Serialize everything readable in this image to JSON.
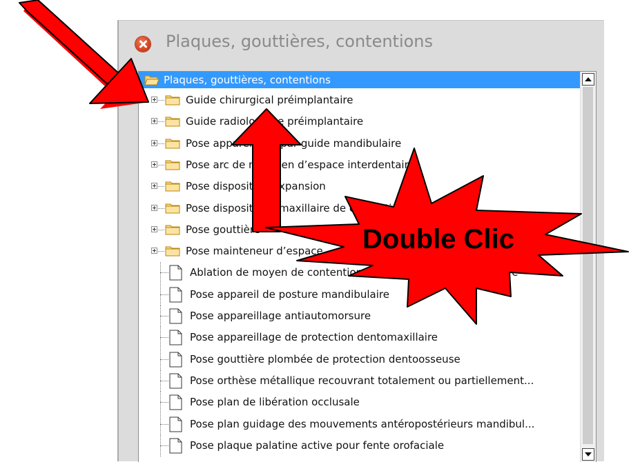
{
  "window": {
    "title": "Plaques, gouttières, contentions"
  },
  "tree": {
    "root_label": "Plaques, gouttières, contentions",
    "folders": [
      "Guide chirurgical préimplantaire",
      "Guide radiologique préimplantaire",
      "Pose appareillage par guide mandibulaire",
      "Pose arc de maintien d’espace interdentaire",
      "Pose dispositif d’expansion",
      "Pose dispositif unimaxillaire de contention dentaire",
      "Pose gouttière",
      "Pose mainteneur d’espace"
    ],
    "documents": [
      "Ablation de moyen de contention maxillaire et/ou mandibulaire",
      "Pose appareil de posture mandibulaire",
      "Pose appareillage antiautomorsure",
      "Pose appareillage de protection dentomaxillaire",
      "Pose gouttière plombée de protection dentoosseuse",
      "Pose orthèse métallique recouvrant totalement ou partiellement...",
      "Pose plan de libération occlusale",
      "Pose plan guidage des mouvements antéropostérieurs mandibul...",
      "Pose plaque palatine active pour fente orofaciale"
    ]
  },
  "annotation": {
    "burst_label": "Double Clic",
    "arrow_color": "#ff0000",
    "selection_color": "#3399ff"
  },
  "icons": {
    "close": "close-icon",
    "folder": "folder-icon",
    "document": "document-icon",
    "expand": "plus-box-icon",
    "scroll_up": "scroll-up-arrow-icon",
    "scroll_down": "scroll-down-arrow-icon"
  }
}
